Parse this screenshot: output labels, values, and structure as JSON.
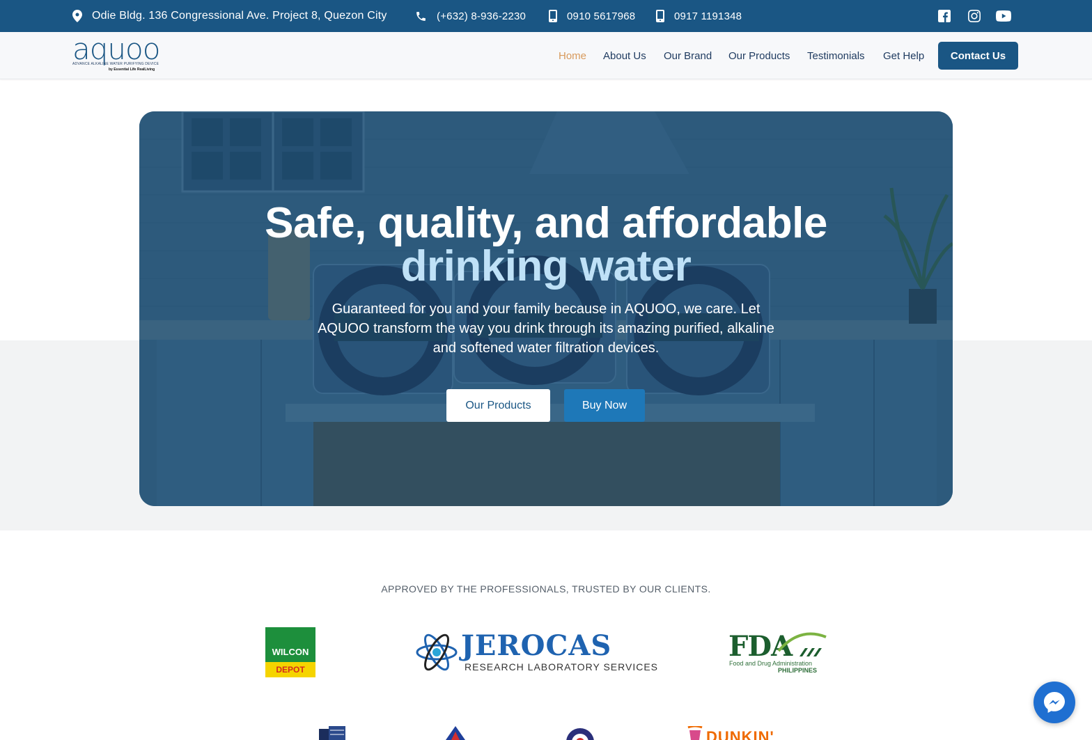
{
  "topbar": {
    "address": "Odie Bldg. 136 Congressional Ave. Project 8, Quezon City",
    "phone_landline": "(+632) 8-936-2230",
    "phone_mobile_1": "0910 5617968",
    "phone_mobile_2": "0917 1191348",
    "socials": [
      "facebook-icon",
      "instagram-icon",
      "youtube-icon"
    ]
  },
  "header": {
    "logo_word": "aquoo",
    "logo_tagline": "ADVANCE ALKALINE   WATER PURIFYING DEVICE",
    "logo_by": "by Essential Life RealLiving",
    "nav": {
      "home": "Home",
      "about": "About Us",
      "brand": "Our Brand",
      "products": "Our Products",
      "testimonials": "Testimonials",
      "help": "Get Help"
    },
    "contact_label": "Contact Us"
  },
  "hero": {
    "title_line1": "Safe, quality, and affordable",
    "title_line2": "drinking water",
    "subtitle": "Guaranteed for you and your family because in AQUOO, we care. Let AQUOO transform the way you drink through its amazing purified, alkaline and softened water filtration devices.",
    "btn_products": "Our Products",
    "btn_buy": "Buy Now"
  },
  "partners": {
    "heading": "APPROVED BY THE PROFESSIONALS, TRUSTED BY OUR CLIENTS.",
    "wilcon_line1": "WILCON",
    "wilcon_line2": "DEPOT",
    "jerocas_name": "JEROCAS",
    "jerocas_sub": "RESEARCH LABORATORY SERVICES",
    "fda_name": "FDA",
    "fda_line1": "Food and Drug Administration",
    "fda_line2": "PHILIPPINES",
    "dunkin": "DUNKIN'"
  },
  "colors": {
    "brand_blue": "#1a5684",
    "active_nav": "#d89a5c",
    "button_blue": "#1e78b8"
  }
}
